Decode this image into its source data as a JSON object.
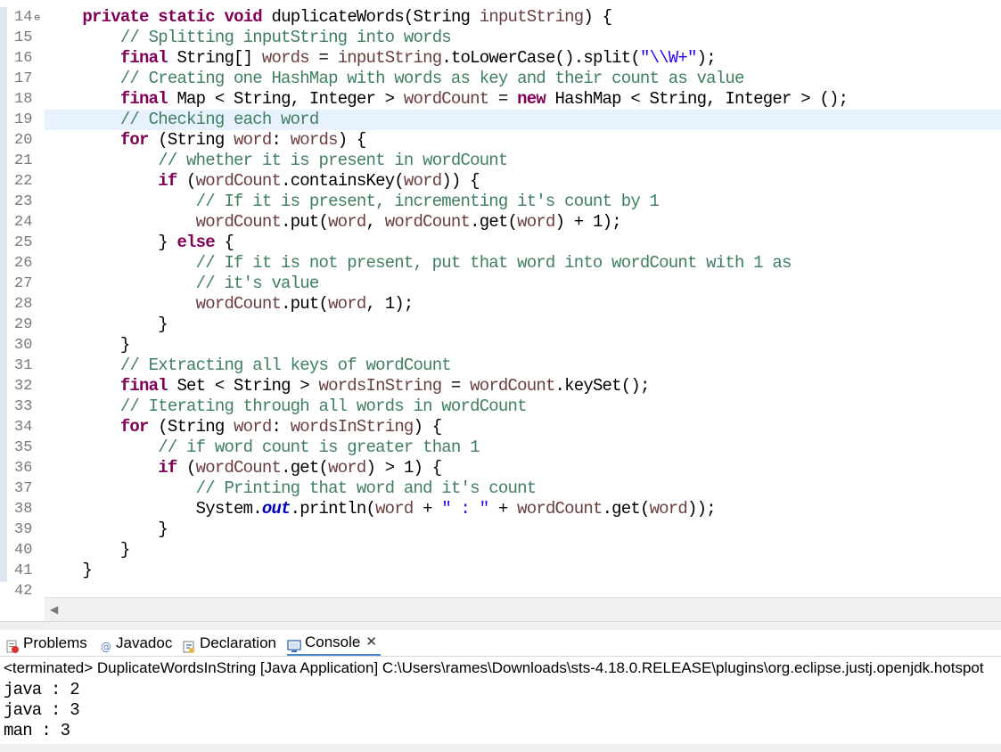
{
  "editor": {
    "lines": [
      {
        "n": "14",
        "fold": true,
        "current": false,
        "tokens": [
          [
            "pl",
            "    "
          ],
          [
            "kw",
            "private"
          ],
          [
            "pl",
            " "
          ],
          [
            "kw",
            "static"
          ],
          [
            "pl",
            " "
          ],
          [
            "kw",
            "void"
          ],
          [
            "pl",
            " duplicateWords(String "
          ],
          [
            "vr",
            "inputString"
          ],
          [
            "pl",
            ") {"
          ]
        ]
      },
      {
        "n": "15",
        "current": false,
        "tokens": [
          [
            "pl",
            "        "
          ],
          [
            "cm",
            "// Splitting inputString into words"
          ]
        ]
      },
      {
        "n": "16",
        "current": false,
        "tokens": [
          [
            "pl",
            "        "
          ],
          [
            "kw",
            "final"
          ],
          [
            "pl",
            " String[] "
          ],
          [
            "vr",
            "words"
          ],
          [
            "pl",
            " = "
          ],
          [
            "vr",
            "inputString"
          ],
          [
            "pl",
            ".toLowerCase().split("
          ],
          [
            "st",
            "\"\\\\W+\""
          ],
          [
            "pl",
            ");"
          ]
        ]
      },
      {
        "n": "17",
        "current": false,
        "tokens": [
          [
            "pl",
            "        "
          ],
          [
            "cm",
            "// Creating one HashMap with words as key and their count as value"
          ]
        ]
      },
      {
        "n": "18",
        "current": false,
        "tokens": [
          [
            "pl",
            "        "
          ],
          [
            "kw",
            "final"
          ],
          [
            "pl",
            " Map < String, Integer > "
          ],
          [
            "vr",
            "wordCount"
          ],
          [
            "pl",
            " = "
          ],
          [
            "kw",
            "new"
          ],
          [
            "pl",
            " HashMap < String, Integer > ();"
          ]
        ]
      },
      {
        "n": "19",
        "current": true,
        "tokens": [
          [
            "pl",
            "        "
          ],
          [
            "cm",
            "// Checking each word"
          ]
        ]
      },
      {
        "n": "20",
        "current": false,
        "tokens": [
          [
            "pl",
            "        "
          ],
          [
            "kw",
            "for"
          ],
          [
            "pl",
            " (String "
          ],
          [
            "vr",
            "word"
          ],
          [
            "pl",
            ": "
          ],
          [
            "vr",
            "words"
          ],
          [
            "pl",
            ") {"
          ]
        ]
      },
      {
        "n": "21",
        "current": false,
        "tokens": [
          [
            "pl",
            "            "
          ],
          [
            "cm",
            "// whether it is present in wordCount"
          ]
        ]
      },
      {
        "n": "22",
        "current": false,
        "tokens": [
          [
            "pl",
            "            "
          ],
          [
            "kw",
            "if"
          ],
          [
            "pl",
            " ("
          ],
          [
            "vr",
            "wordCount"
          ],
          [
            "pl",
            ".containsKey("
          ],
          [
            "vr",
            "word"
          ],
          [
            "pl",
            ")) {"
          ]
        ]
      },
      {
        "n": "23",
        "current": false,
        "tokens": [
          [
            "pl",
            "                "
          ],
          [
            "cm",
            "// If it is present, incrementing it's count by 1"
          ]
        ]
      },
      {
        "n": "24",
        "current": false,
        "tokens": [
          [
            "pl",
            "                "
          ],
          [
            "vr",
            "wordCount"
          ],
          [
            "pl",
            ".put("
          ],
          [
            "vr",
            "word"
          ],
          [
            "pl",
            ", "
          ],
          [
            "vr",
            "wordCount"
          ],
          [
            "pl",
            ".get("
          ],
          [
            "vr",
            "word"
          ],
          [
            "pl",
            ") + 1);"
          ]
        ]
      },
      {
        "n": "25",
        "current": false,
        "tokens": [
          [
            "pl",
            "            } "
          ],
          [
            "kw",
            "else"
          ],
          [
            "pl",
            " {"
          ]
        ]
      },
      {
        "n": "26",
        "current": false,
        "tokens": [
          [
            "pl",
            "                "
          ],
          [
            "cm",
            "// If it is not present, put that word into wordCount with 1 as"
          ]
        ]
      },
      {
        "n": "27",
        "current": false,
        "tokens": [
          [
            "pl",
            "                "
          ],
          [
            "cm",
            "// it's value"
          ]
        ]
      },
      {
        "n": "28",
        "current": false,
        "tokens": [
          [
            "pl",
            "                "
          ],
          [
            "vr",
            "wordCount"
          ],
          [
            "pl",
            ".put("
          ],
          [
            "vr",
            "word"
          ],
          [
            "pl",
            ", 1);"
          ]
        ]
      },
      {
        "n": "29",
        "current": false,
        "tokens": [
          [
            "pl",
            "            }"
          ]
        ]
      },
      {
        "n": "30",
        "current": false,
        "tokens": [
          [
            "pl",
            "        }"
          ]
        ]
      },
      {
        "n": "31",
        "current": false,
        "tokens": [
          [
            "pl",
            "        "
          ],
          [
            "cm",
            "// Extracting all keys of wordCount"
          ]
        ]
      },
      {
        "n": "32",
        "current": false,
        "tokens": [
          [
            "pl",
            "        "
          ],
          [
            "kw",
            "final"
          ],
          [
            "pl",
            " Set < String > "
          ],
          [
            "vr",
            "wordsInString"
          ],
          [
            "pl",
            " = "
          ],
          [
            "vr",
            "wordCount"
          ],
          [
            "pl",
            ".keySet();"
          ]
        ]
      },
      {
        "n": "33",
        "current": false,
        "tokens": [
          [
            "pl",
            "        "
          ],
          [
            "cm",
            "// Iterating through all words in wordCount"
          ]
        ]
      },
      {
        "n": "34",
        "current": false,
        "tokens": [
          [
            "pl",
            "        "
          ],
          [
            "kw",
            "for"
          ],
          [
            "pl",
            " (String "
          ],
          [
            "vr",
            "word"
          ],
          [
            "pl",
            ": "
          ],
          [
            "vr",
            "wordsInString"
          ],
          [
            "pl",
            ") {"
          ]
        ]
      },
      {
        "n": "35",
        "current": false,
        "tokens": [
          [
            "pl",
            "            "
          ],
          [
            "cm",
            "// if word count is greater than 1"
          ]
        ]
      },
      {
        "n": "36",
        "current": false,
        "tokens": [
          [
            "pl",
            "            "
          ],
          [
            "kw",
            "if"
          ],
          [
            "pl",
            " ("
          ],
          [
            "vr",
            "wordCount"
          ],
          [
            "pl",
            ".get("
          ],
          [
            "vr",
            "word"
          ],
          [
            "pl",
            ") > 1) {"
          ]
        ]
      },
      {
        "n": "37",
        "current": false,
        "tokens": [
          [
            "pl",
            "                "
          ],
          [
            "cm",
            "// Printing that word and it's count"
          ]
        ]
      },
      {
        "n": "38",
        "current": false,
        "tokens": [
          [
            "pl",
            "                System."
          ],
          [
            "fd",
            "out"
          ],
          [
            "pl",
            ".println("
          ],
          [
            "vr",
            "word"
          ],
          [
            "pl",
            " + "
          ],
          [
            "st",
            "\" : \""
          ],
          [
            "pl",
            " + "
          ],
          [
            "vr",
            "wordCount"
          ],
          [
            "pl",
            ".get("
          ],
          [
            "vr",
            "word"
          ],
          [
            "pl",
            "));"
          ]
        ]
      },
      {
        "n": "39",
        "current": false,
        "tokens": [
          [
            "pl",
            "            }"
          ]
        ]
      },
      {
        "n": "40",
        "current": false,
        "tokens": [
          [
            "pl",
            "        }"
          ]
        ]
      },
      {
        "n": "41",
        "current": false,
        "tokens": [
          [
            "pl",
            "    }"
          ]
        ]
      },
      {
        "n": "42",
        "current": false,
        "tokens": [
          [
            "pl",
            ""
          ]
        ]
      }
    ]
  },
  "panel": {
    "tabs": [
      {
        "label": "Problems",
        "icon": "problems-icon",
        "active": false
      },
      {
        "label": "Javadoc",
        "icon": "javadoc-icon",
        "active": false
      },
      {
        "label": "Declaration",
        "icon": "declaration-icon",
        "active": false
      },
      {
        "label": "Console",
        "icon": "console-icon",
        "active": true,
        "closable": true
      }
    ],
    "status": "<terminated> DuplicateWordsInString [Java Application] C:\\Users\\rames\\Downloads\\sts-4.18.0.RELEASE\\plugins\\org.eclipse.justj.openjdk.hotspot",
    "output": [
      "java : 2",
      "java : 3",
      "man : 3"
    ]
  },
  "colors": {
    "keyword": "#7f0055",
    "comment": "#3f7f5f",
    "string": "#2a00ff",
    "variable": "#6a3e3e",
    "field": "#0000c0",
    "currentLine": "#e8f2fe"
  }
}
